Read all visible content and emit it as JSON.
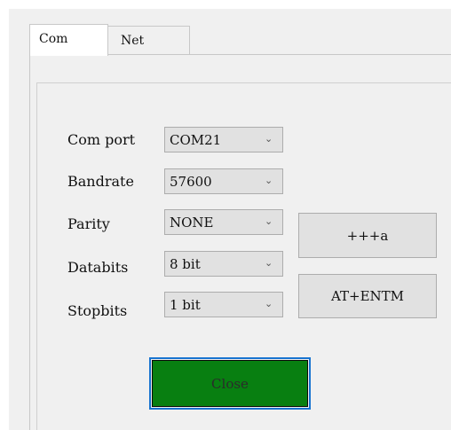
{
  "tabs": [
    {
      "label": "Com",
      "active": true
    },
    {
      "label": "Net",
      "active": false
    }
  ],
  "fields": [
    {
      "label": "Com port",
      "value": "COM21"
    },
    {
      "label": "Bandrate",
      "value": "57600"
    },
    {
      "label": "Parity",
      "value": "NONE"
    },
    {
      "label": "Databits",
      "value": "8 bit"
    },
    {
      "label": "Stopbits",
      "value": "1 bit"
    }
  ],
  "buttons": {
    "plus_a": "+++a",
    "at_entm": "AT+ENTM",
    "close": "Close"
  },
  "icons": {
    "dropdown": "chevron-down-icon"
  },
  "colors": {
    "close_fill": "#087f11",
    "focus_border": "#1874d0"
  }
}
